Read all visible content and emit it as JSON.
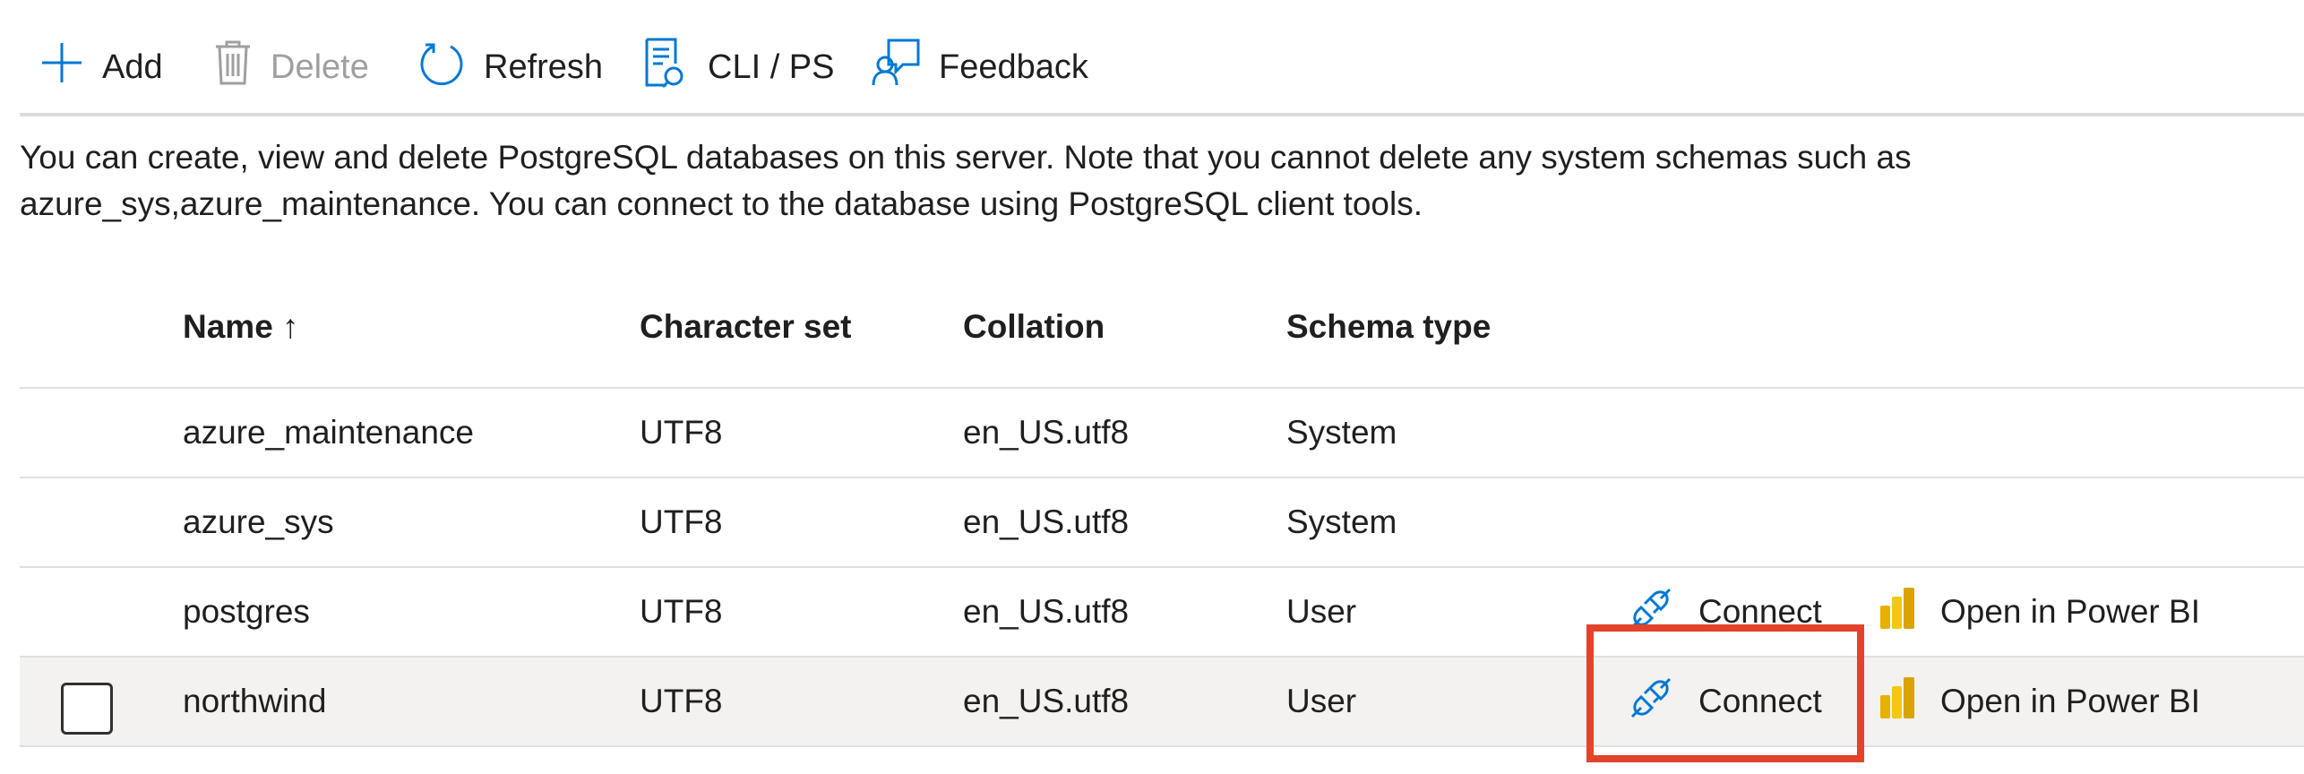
{
  "toolbar": {
    "add_label": "Add",
    "delete_label": "Delete",
    "refresh_label": "Refresh",
    "cli_label": "CLI / PS",
    "feedback_label": "Feedback"
  },
  "description": "You can create, view and delete PostgreSQL databases on this server. Note that you cannot delete any system schemas such as azure_sys,azure_maintenance. You can connect to the database using PostgreSQL client tools.",
  "table": {
    "columns": {
      "name": "Name ↑",
      "charset": "Character set",
      "collation": "Collation",
      "schema_type": "Schema type"
    },
    "rows": [
      {
        "name": "azure_maintenance",
        "charset": "UTF8",
        "collation": "en_US.utf8",
        "schema_type": "System"
      },
      {
        "name": "azure_sys",
        "charset": "UTF8",
        "collation": "en_US.utf8",
        "schema_type": "System"
      },
      {
        "name": "postgres",
        "charset": "UTF8",
        "collation": "en_US.utf8",
        "schema_type": "User",
        "connect_label": "Connect",
        "powerbi_label": "Open in Power BI"
      },
      {
        "name": "northwind",
        "charset": "UTF8",
        "collation": "en_US.utf8",
        "schema_type": "User",
        "connect_label": "Connect",
        "powerbi_label": "Open in Power BI"
      }
    ]
  },
  "colors": {
    "accent": "#0078d4",
    "highlight": "#e3432b",
    "powerbi_yellow": "#f2c811",
    "selected_row": "#f3f2f1"
  },
  "icons": [
    "add-icon",
    "delete-icon",
    "refresh-icon",
    "cli-icon",
    "feedback-icon",
    "connect-icon",
    "powerbi-icon"
  ]
}
